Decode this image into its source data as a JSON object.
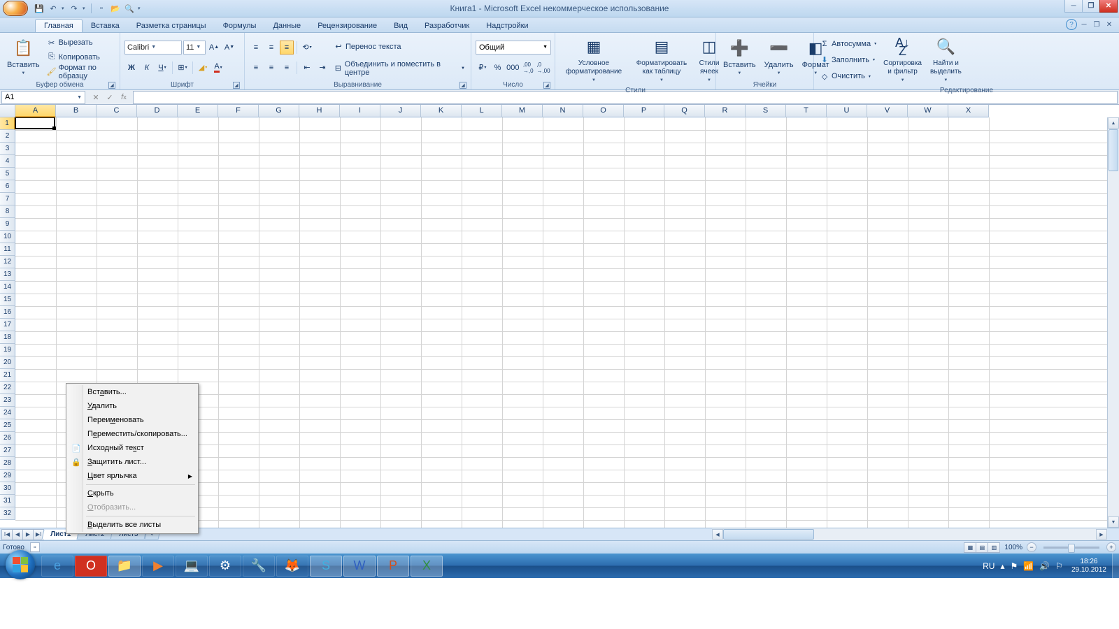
{
  "title": "Книга1 - Microsoft Excel некоммерческое использование",
  "tabs": [
    "Главная",
    "Вставка",
    "Разметка страницы",
    "Формулы",
    "Данные",
    "Рецензирование",
    "Вид",
    "Разработчик",
    "Надстройки"
  ],
  "clipboard": {
    "paste": "Вставить",
    "cut": "Вырезать",
    "copy": "Копировать",
    "format_painter": "Формат по образцу",
    "label": "Буфер обмена"
  },
  "font": {
    "name": "Calibri",
    "size": "11",
    "label": "Шрифт"
  },
  "alignment": {
    "wrap": "Перенос текста",
    "merge": "Объединить и поместить в центре",
    "label": "Выравнивание"
  },
  "number": {
    "format": "Общий",
    "label": "Число"
  },
  "styles": {
    "cond": "Условное форматирование",
    "table": "Форматировать как таблицу",
    "cell": "Стили ячеек",
    "label": "Стили"
  },
  "cells": {
    "insert": "Вставить",
    "delete": "Удалить",
    "format": "Формат",
    "label": "Ячейки"
  },
  "editing": {
    "autosum": "Автосумма",
    "fill": "Заполнить",
    "clear": "Очистить",
    "sort": "Сортировка и фильтр",
    "find": "Найти и выделить",
    "label": "Редактирование"
  },
  "name_box": "A1",
  "columns": [
    "A",
    "B",
    "C",
    "D",
    "E",
    "F",
    "G",
    "H",
    "I",
    "J",
    "K",
    "L",
    "M",
    "N",
    "O",
    "P",
    "Q",
    "R",
    "S",
    "T",
    "U",
    "V",
    "W",
    "X"
  ],
  "rows": 32,
  "sheet_tabs": [
    "Лист1",
    "Лист2",
    "Лист3"
  ],
  "status": "Готово",
  "zoom": "100%",
  "lang": "RU",
  "clock": {
    "time": "18:26",
    "date": "29.10.2012"
  },
  "context_menu": {
    "insert": "Вставить...",
    "delete": "Удалить",
    "rename": "Переименовать",
    "move": "Переместить/скопировать...",
    "source": "Исходный текст",
    "protect": "Защитить лист...",
    "color": "Цвет ярлычка",
    "hide": "Скрыть",
    "unhide": "Отобразить...",
    "select_all": "Выделить все листы"
  }
}
